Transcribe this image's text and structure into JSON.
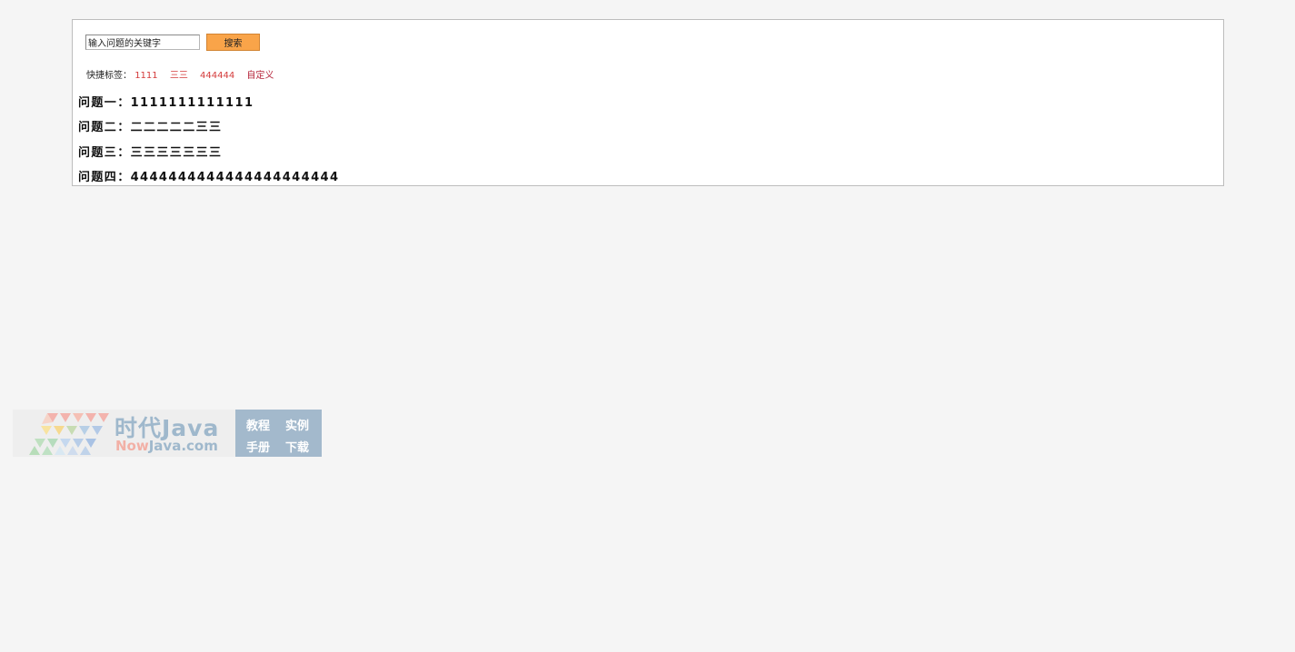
{
  "search": {
    "value": "输入问题的关键字",
    "button_label": "搜索"
  },
  "tags": {
    "label": "快捷标签：",
    "items": [
      "1111",
      "三三",
      "444444",
      "自定义"
    ]
  },
  "questions": [
    "问题一：1111111111111",
    "问题二：二二二二二三三",
    "问题三：三三三三三三三",
    "问题四：4444444444444444444444"
  ],
  "watermark": {
    "title": "时代Java",
    "subtitle_now": "Now",
    "subtitle_rest": "Java.com",
    "links": [
      "教程",
      "实例",
      "手册",
      "下载"
    ]
  },
  "colors": {
    "background": "#f5f5f5",
    "button": "#f9a449",
    "tag": "#d43b3b"
  }
}
